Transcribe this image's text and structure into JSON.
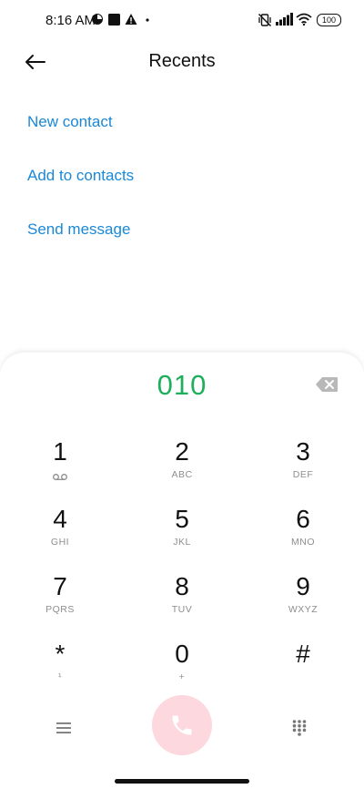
{
  "status_bar": {
    "time": "8:16 AM",
    "battery": "100",
    "icons": [
      "app-notification-icon",
      "square-notification-icon",
      "warning-icon",
      "dot-icon",
      "vibrate-off-icon",
      "signal-icon",
      "wifi-icon",
      "battery-icon"
    ]
  },
  "header": {
    "title": "Recents",
    "back_icon": "arrow-left-icon"
  },
  "actions": [
    {
      "label": "New contact"
    },
    {
      "label": "Add to contacts"
    },
    {
      "label": "Send message"
    }
  ],
  "dialpad": {
    "number": "010",
    "number_color": "#1fae5b",
    "keys": [
      {
        "digit": "1",
        "letters": "",
        "sub_icon": "voicemail-icon"
      },
      {
        "digit": "2",
        "letters": "ABC"
      },
      {
        "digit": "3",
        "letters": "DEF"
      },
      {
        "digit": "4",
        "letters": "GHI"
      },
      {
        "digit": "5",
        "letters": "JKL"
      },
      {
        "digit": "6",
        "letters": "MNO"
      },
      {
        "digit": "7",
        "letters": "PQRS"
      },
      {
        "digit": "8",
        "letters": "TUV"
      },
      {
        "digit": "9",
        "letters": "WXYZ"
      },
      {
        "digit": "*",
        "letters": "¹"
      },
      {
        "digit": "0",
        "letters": "+"
      },
      {
        "digit": "#",
        "letters": ""
      }
    ]
  },
  "bottom_bar": {
    "menu_icon": "menu-icon",
    "call_icon": "phone-icon",
    "keypad_icon": "dialpad-grid-icon",
    "call_color": "#fdd9df"
  },
  "accent_color": "#1a88d6"
}
